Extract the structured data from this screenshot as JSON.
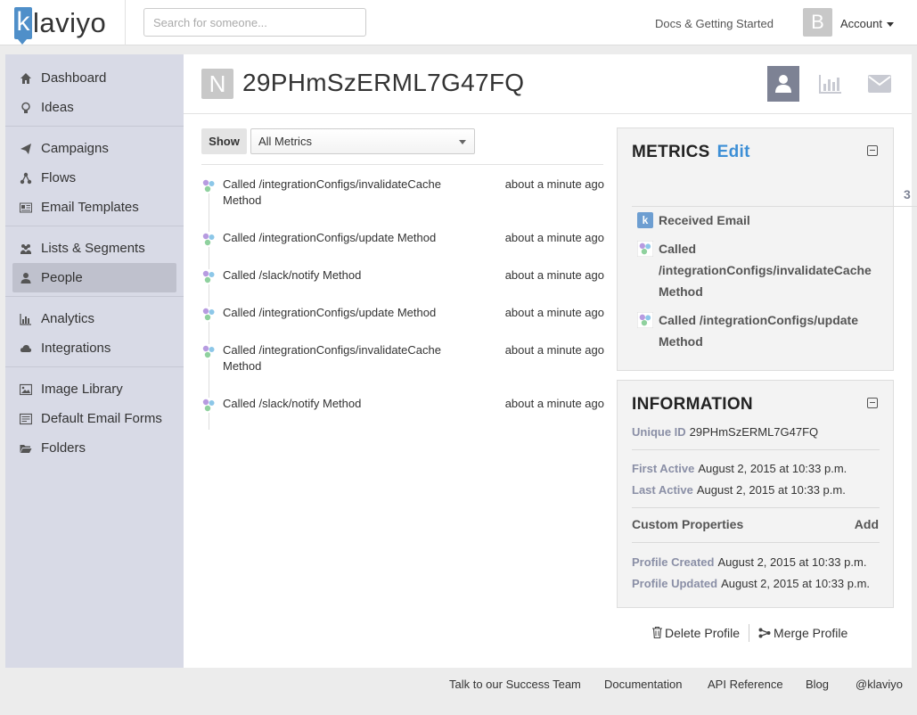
{
  "topbar": {
    "logo_initial": "k",
    "logo_text": "laviyo",
    "search_placeholder": "Search for someone...",
    "docs_link": "Docs & Getting Started",
    "avatar_initial": "B",
    "account_label": "Account"
  },
  "sidebar": {
    "groups": [
      [
        {
          "label": "Dashboard",
          "icon": "home-icon"
        },
        {
          "label": "Ideas",
          "icon": "lightbulb-icon"
        }
      ],
      [
        {
          "label": "Campaigns",
          "icon": "paper-plane-icon"
        },
        {
          "label": "Flows",
          "icon": "flow-icon"
        },
        {
          "label": "Email Templates",
          "icon": "template-icon"
        }
      ],
      [
        {
          "label": "Lists & Segments",
          "icon": "users-icon"
        },
        {
          "label": "People",
          "icon": "person-icon",
          "active": true
        }
      ],
      [
        {
          "label": "Analytics",
          "icon": "bar-chart-icon"
        },
        {
          "label": "Integrations",
          "icon": "cloud-icon"
        }
      ],
      [
        {
          "label": "Image Library",
          "icon": "image-icon"
        },
        {
          "label": "Default Email Forms",
          "icon": "form-icon"
        },
        {
          "label": "Folders",
          "icon": "folder-icon"
        }
      ]
    ]
  },
  "profile": {
    "initial": "N",
    "title": "29PHmSzERML7G47FQ"
  },
  "feed": {
    "show_label": "Show",
    "filter_value": "All Metrics",
    "events": [
      {
        "text": "Called /integrationConfigs/invalidateCache Method",
        "time": "about a minute ago"
      },
      {
        "text": "Called /integrationConfigs/update Method",
        "time": "about a minute ago"
      },
      {
        "text": "Called /slack/notify Method",
        "time": "about a minute ago"
      },
      {
        "text": "Called /integrationConfigs/update Method",
        "time": "about a minute ago"
      },
      {
        "text": "Called /integrationConfigs/invalidateCache Method",
        "time": "about a minute ago"
      },
      {
        "text": "Called /slack/notify Method",
        "time": "about a minute ago"
      }
    ]
  },
  "metrics": {
    "title": "METRICS",
    "edit_label": "Edit",
    "side_count": "3",
    "items": [
      {
        "label": "Received Email",
        "icon": "klaviyo-k-icon",
        "icon_text": "k"
      },
      {
        "label": "Called /integrationConfigs/invalidateCache Method",
        "icon": "api-metric-icon"
      },
      {
        "label": "Called /integrationConfigs/update Method",
        "icon": "api-metric-icon"
      }
    ]
  },
  "information": {
    "title": "INFORMATION",
    "unique_id_label": "Unique ID",
    "unique_id": "29PHmSzERML7G47FQ",
    "first_active_label": "First Active",
    "first_active": "August 2, 2015 at 10:33 p.m.",
    "last_active_label": "Last Active",
    "last_active": "August 2, 2015 at 10:33 p.m.",
    "custom_properties_label": "Custom Properties",
    "add_label": "Add",
    "profile_created_label": "Profile Created",
    "profile_created": "August 2, 2015 at 10:33 p.m.",
    "profile_updated_label": "Profile Updated",
    "profile_updated": "August 2, 2015 at 10:33 p.m."
  },
  "actions": {
    "delete_label": "Delete Profile",
    "merge_label": "Merge Profile"
  },
  "footer": {
    "links": [
      "Talk to our Success Team",
      "Documentation",
      "API Reference",
      "Blog",
      "@klaviyo"
    ]
  },
  "colors": {
    "accent": "#3d8fd6",
    "sidebar_bg": "#d8dae6",
    "active_nav": "#bfc1cd",
    "header_button_active": "#7d8294"
  }
}
